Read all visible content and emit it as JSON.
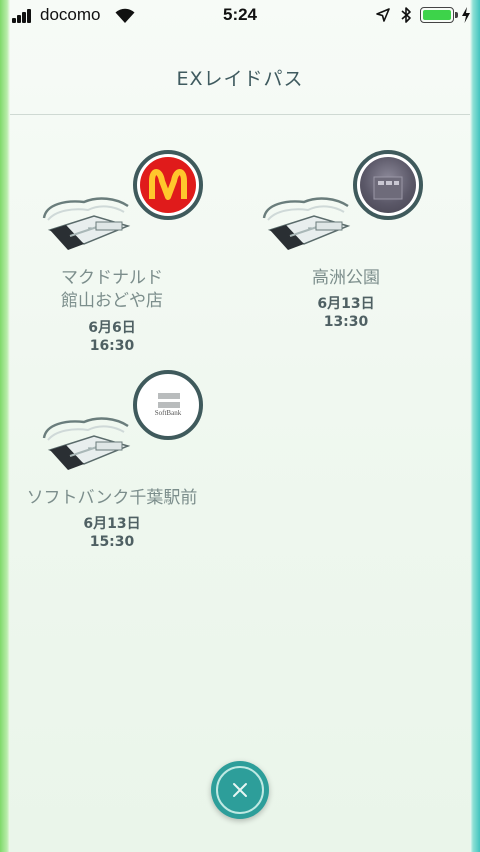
{
  "status_bar": {
    "carrier": "docomo",
    "time": "5:24"
  },
  "header": {
    "title": "EXレイドパス"
  },
  "passes": [
    {
      "name_line1": "マクドナルド",
      "name_line2": "館山おどや店",
      "date": "6月6日",
      "time": "16:30",
      "badge": "mcdonalds-logo"
    },
    {
      "name_line1": "高洲公園",
      "name_line2": "",
      "date": "6月13日",
      "time": "13:30",
      "badge": "gym-photo"
    },
    {
      "name_line1": "ソフトバンク千葉駅前",
      "name_line2": "",
      "date": "6月13日",
      "time": "15:30",
      "badge": "softbank-logo",
      "badge_text": "SoftBank"
    }
  ],
  "colors": {
    "accent": "#2d9e9a",
    "badge_border": "#3f5a5c",
    "mcdonalds_red": "#e01b1b",
    "mcdonalds_gold": "#ffc72c",
    "battery": "#3dd34a"
  },
  "icons": {
    "close": "close-icon"
  }
}
